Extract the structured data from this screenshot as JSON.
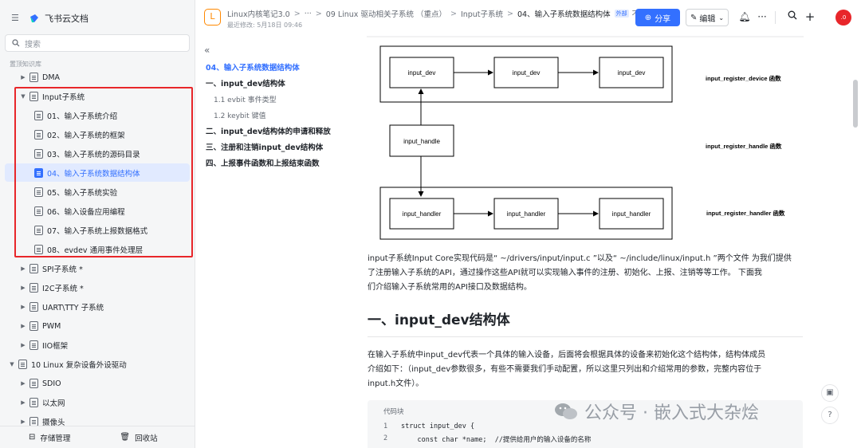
{
  "sidebar": {
    "app_name": "飞书云文档",
    "search_placeholder": "搜索",
    "section_label": "置顶知识库",
    "items": [
      {
        "label": "DMA"
      },
      {
        "label": "Input子系统"
      },
      {
        "label": "01、输入子系统介绍"
      },
      {
        "label": "02、输入子系统的框架"
      },
      {
        "label": "03、输入子系统的源码目录"
      },
      {
        "label": "04、输入子系统数据结构体"
      },
      {
        "label": "05、输入子系统实验"
      },
      {
        "label": "06、输入设备应用编程"
      },
      {
        "label": "07、输入子系统上报数据格式"
      },
      {
        "label": "08、evdev 通用事件处理层"
      },
      {
        "label": "SPI子系统 *"
      },
      {
        "label": "I2C子系统 *"
      },
      {
        "label": "UART\\TTY 子系统"
      },
      {
        "label": "PWM"
      },
      {
        "label": "IIO框架"
      },
      {
        "label": "10 Linux 复杂设备外设驱动"
      },
      {
        "label": "SDIO"
      },
      {
        "label": "以太网"
      },
      {
        "label": "摄像头"
      }
    ],
    "footer": {
      "storage": "存储管理",
      "trash": "回收站"
    }
  },
  "header": {
    "breadcrumbs": [
      "Linux内核笔记3.0",
      "···",
      "09 Linux 驱动相关子系统 （重点）",
      "Input子系统",
      "04、输入子系统数据结构体"
    ],
    "external_badge": "外部",
    "truncated": "不",
    "modified": "最近修改: 5月18日 09:46",
    "share_label": "分享",
    "edit_label": "编辑",
    "avatar_text": ".0"
  },
  "toc": [
    {
      "label": "04、输入子系统数据结构体",
      "level": "title"
    },
    {
      "label": "一、input_dev结构体",
      "level": "h1"
    },
    {
      "label": "1.1 evbit 事件类型",
      "level": "h2"
    },
    {
      "label": "1.2 keybit 键值",
      "level": "h2"
    },
    {
      "label": "二、input_dev结构体的申请和释放",
      "level": "h1"
    },
    {
      "label": "三、注册和注销input_dev结构体",
      "level": "h1"
    },
    {
      "label": "四、上报事件函数和上报结束函数",
      "level": "h1"
    }
  ],
  "diagram": {
    "row1": [
      "input_dev",
      "input_dev",
      "input_dev"
    ],
    "row1_label": "input_register_device 函数",
    "mid": "input_handle",
    "mid_label": "input_register_handle 函数",
    "row3": [
      "input_handler",
      "input_handler",
      "input_handler"
    ],
    "row3_label": "input_register_handler 函数"
  },
  "content": {
    "para1_lines": [
      "input子系统Input Core实现代码是“ ~/drivers/input/input.c ”以及“ ~/include/linux/input.h ”两个文件 为我们提供",
      "了注册输入子系统的API，通过操作这些API就可以实现输入事件的注册、初始化、上报、注销等等工作。 下面我",
      "们介绍输入子系统常用的API接口及数据结构。"
    ],
    "heading": "一、input_dev结构体",
    "para2_lines": [
      "在输入子系统中input_dev代表一个具体的输入设备，后面将会根据具体的设备来初始化这个结构体，结构体成员",
      "介绍如下：（input_dev参数很多，有些不需要我们手动配置，所以这里只列出和介绍常用的参数，完整内容位于",
      "input.h文件）。"
    ],
    "code_label": "代码块",
    "code_lines": [
      {
        "n": "1",
        "t": "struct input_dev {"
      },
      {
        "n": "2",
        "t": "    const char *name;  //提供给用户的输入设备的名称"
      }
    ]
  },
  "watermark": "公众号 · 嵌入式大杂烩"
}
